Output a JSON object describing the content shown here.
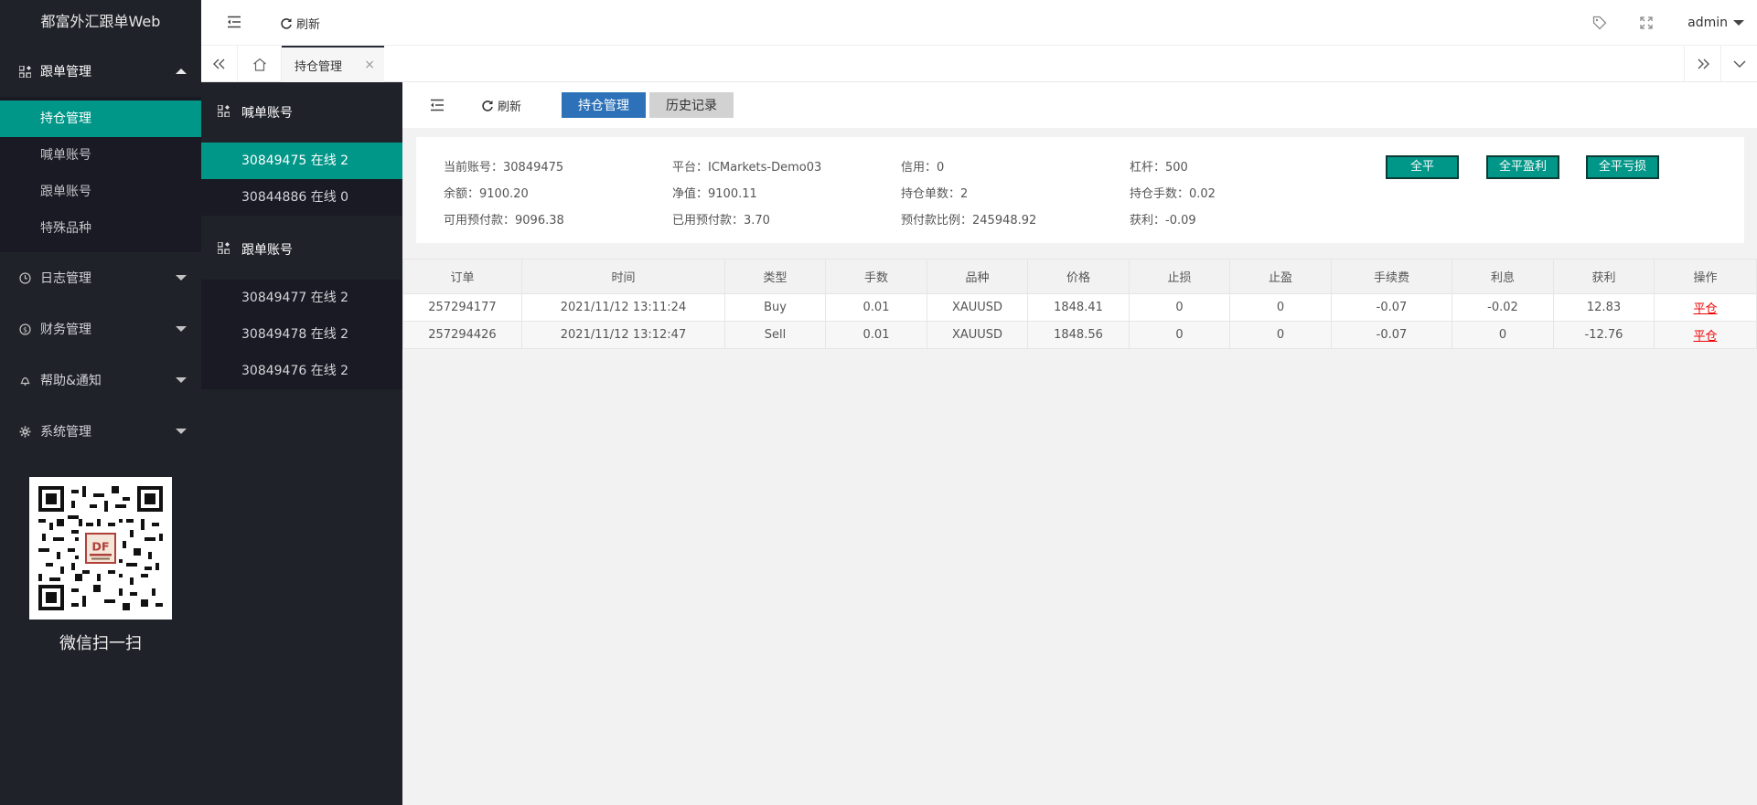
{
  "app": {
    "title": "都富外汇跟单Web",
    "user": "admin"
  },
  "header": {
    "refresh_label": "刷新"
  },
  "sidebar": {
    "groups": [
      {
        "label": "跟单管理",
        "items": [
          "持仓管理",
          "喊单账号",
          "跟单账号",
          "特殊品种"
        ]
      },
      {
        "label": "日志管理"
      },
      {
        "label": "财务管理"
      },
      {
        "label": "帮助&通知"
      },
      {
        "label": "系统管理"
      }
    ],
    "qr_caption": "微信扫一扫"
  },
  "tabs": {
    "active": "持仓管理"
  },
  "accounts": {
    "signal_title": "喊单账号",
    "signal_items": [
      "30849475 在线 2",
      "30844886 在线 0"
    ],
    "follow_title": "跟单账号",
    "follow_items": [
      "30849477 在线 2",
      "30849478 在线 2",
      "30849476 在线 2"
    ]
  },
  "toolbar": {
    "refresh_label": "刷新",
    "positions_label": "持仓管理",
    "history_label": "历史记录"
  },
  "summary": {
    "account": "当前账号：30849475",
    "platform": "平台：ICMarkets-Demo03",
    "credit": "信用：0",
    "leverage": "杠杆：500",
    "balance": "余额：9100.20",
    "equity": "净值：9100.11",
    "positions_count": "持仓单数：2",
    "positions_lots": "持仓手数：0.02",
    "free_margin": "可用预付款：9096.38",
    "used_margin": "已用预付款：3.70",
    "margin_ratio": "预付款比例：245948.92",
    "profit": "获利：-0.09",
    "btn_close_all": "全平",
    "btn_close_profit": "全平盈利",
    "btn_close_loss": "全平亏损"
  },
  "table": {
    "headers": [
      "订单",
      "时间",
      "类型",
      "手数",
      "品种",
      "价格",
      "止损",
      "止盈",
      "手续费",
      "利息",
      "获利",
      "操作"
    ],
    "rows": [
      [
        "257294177",
        "2021/11/12 13:11:24",
        "Buy",
        "0.01",
        "XAUUSD",
        "1848.41",
        "0",
        "0",
        "-0.07",
        "-0.02",
        "12.83",
        "平仓"
      ],
      [
        "257294426",
        "2021/11/12 13:12:47",
        "Sell",
        "0.01",
        "XAUUSD",
        "1848.56",
        "0",
        "0",
        "-0.07",
        "0",
        "-12.76",
        "平仓"
      ]
    ]
  },
  "colors": {
    "accent": "#009688",
    "sidebar": "#20222a",
    "primary": "#2d72b8"
  }
}
